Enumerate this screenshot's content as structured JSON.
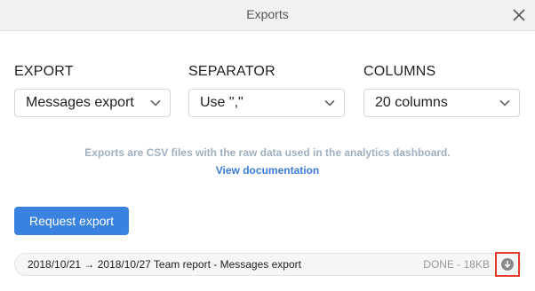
{
  "window": {
    "title": "Exports"
  },
  "export": {
    "label": "EXPORT",
    "value": "Messages export"
  },
  "separator": {
    "label": "SEPARATOR",
    "value": "Use \",\""
  },
  "columns": {
    "label": "COLUMNS",
    "value": "20 columns"
  },
  "info": {
    "text": "Exports are CSV files with the raw data used in the analytics dashboard.",
    "link": "View documentation"
  },
  "request_button": "Request export",
  "exports_list": [
    {
      "name": "2018/10/21 → 2018/10/27 Team report - Messages export",
      "status": "DONE - 18KB"
    }
  ],
  "icons": {
    "close": "close-icon",
    "chevron": "chevron-down-icon",
    "download": "download-icon"
  },
  "colors": {
    "accent": "#3a82e0",
    "link": "#3a7bd5",
    "highlight": "#e53b2c"
  }
}
